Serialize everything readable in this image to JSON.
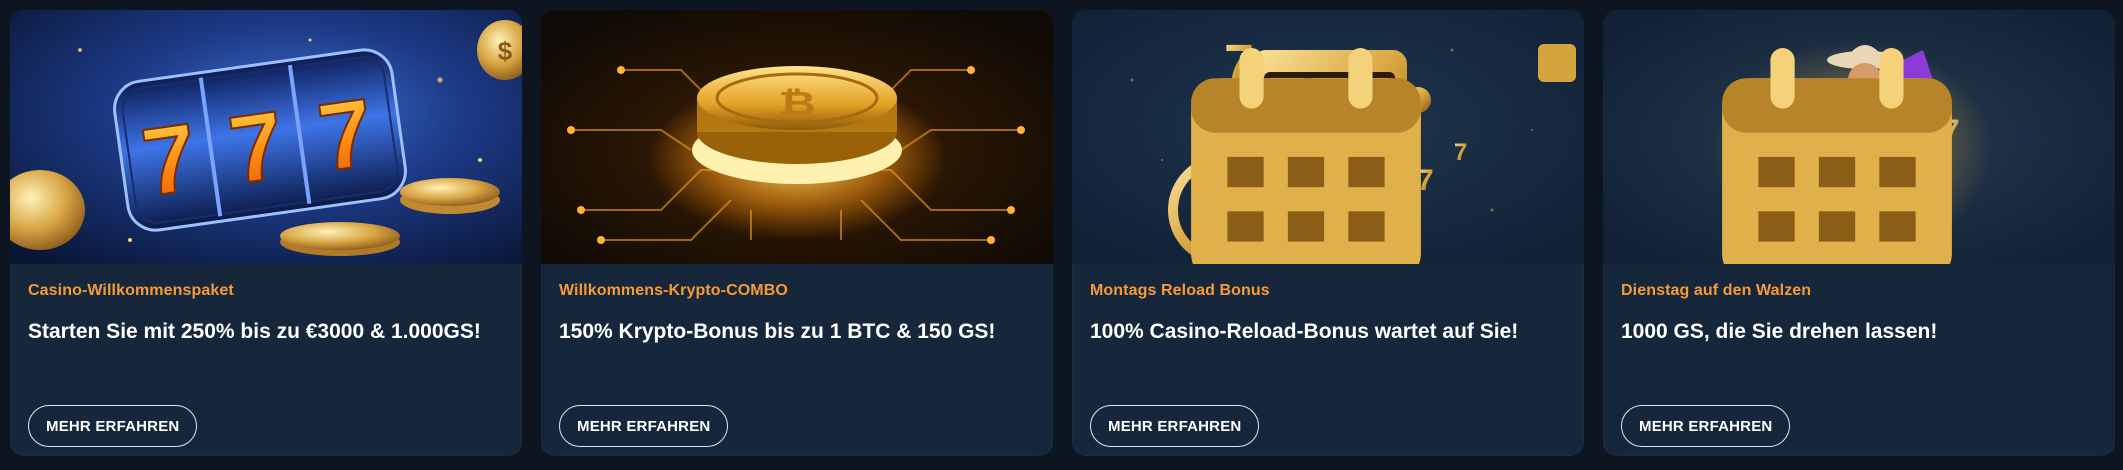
{
  "promotions": [
    {
      "category": "Casino-Willkommenspaket",
      "title": "Starten Sie mit 250% bis zu €3000 & 1.000GS!",
      "button_label": "MEHR ERFAHREN",
      "image_icon": "slot-reels-777-icon"
    },
    {
      "category": "Willkommens-Krypto-COMBO",
      "title": "150% Krypto-Bonus bis zu 1 BTC & 150 GS!",
      "button_label": "MEHR ERFAHREN",
      "image_icon": "bitcoin-coin-icon"
    },
    {
      "category": "Montags Reload Bonus",
      "title": "100% Casino-Reload-Bonus wartet auf Sie!",
      "button_label": "MEHR ERFAHREN",
      "image_icon": "slot-machine-icon",
      "badge_icon": "calendar-icon"
    },
    {
      "category": "Dienstag auf den Walzen",
      "title": "1000 GS, die Sie drehen lassen!",
      "button_label": "MEHR ERFAHREN",
      "image_icon": "cowboy-mascot-icon",
      "badge_icon": "calendar-icon"
    }
  ],
  "colors": {
    "page_background": "#0c1520",
    "card_background": "#16273b",
    "category_accent": "#f79a36",
    "title_text": "#ffffff",
    "button_border": "#dfe6ee"
  }
}
